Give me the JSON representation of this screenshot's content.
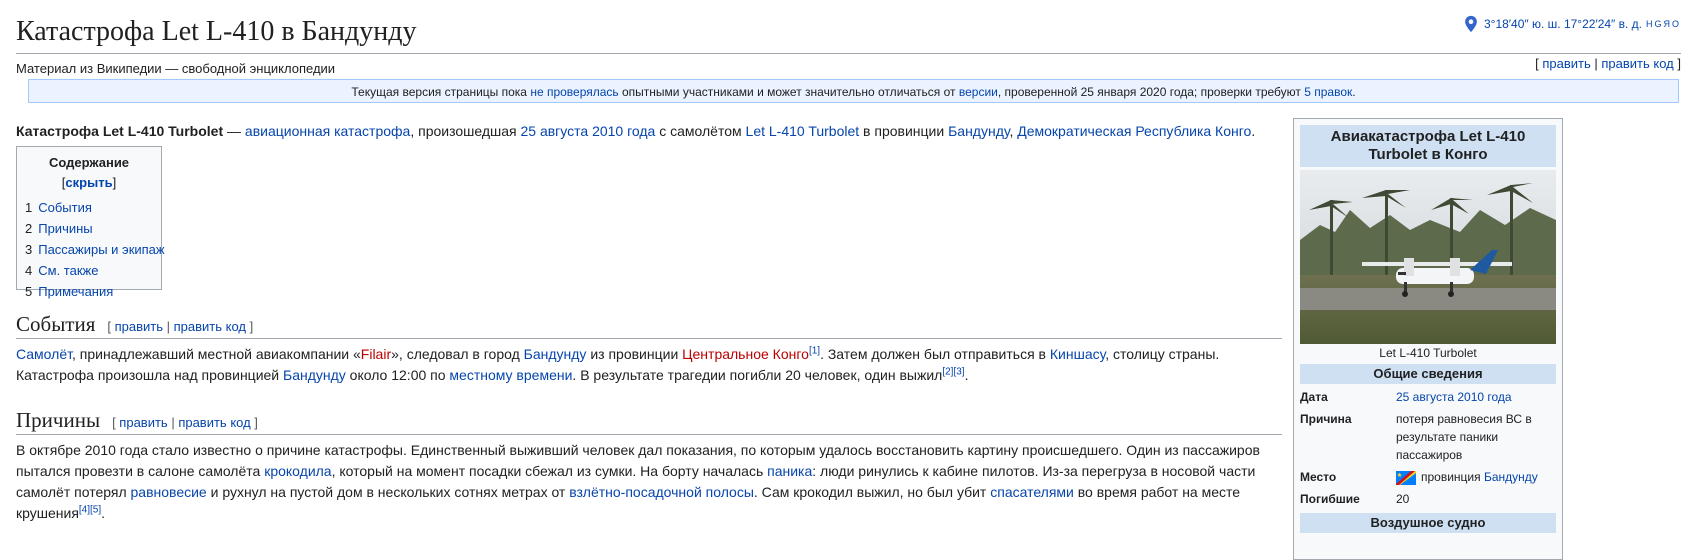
{
  "title": "Катастрофа Let L-410 в Бандунду",
  "tagline": "Материал из Википедии — свободной энциклопедии",
  "coords": {
    "text": "3°18′40″ ю. ш. 17°22′24″ в. д.",
    "geo": "HGЯO"
  },
  "top_edit": {
    "open": "[ ",
    "edit": "править",
    "sep": " | ",
    "edit_code": "править код",
    "close": " ]"
  },
  "notice": {
    "t1": "Текущая версия страницы пока ",
    "l1": "не проверялась",
    "t2": " опытными участниками и может значительно отличаться от ",
    "l2": "версии",
    "t3": ", проверенной 25 января 2020 года; проверки требуют ",
    "l3": "5 правок",
    "t4": "."
  },
  "lead": {
    "bold": "Катастрофа Let L-410 Turbolet",
    "t1": " — ",
    "l1": "авиационная катастрофа",
    "t2": ", произошедшая ",
    "l2": "25 августа 2010 года",
    "t3": " с самолётом ",
    "l3": "Let L-410 Turbolet",
    "t4": " в провинции ",
    "l4": "Бандунду",
    "t5": ", ",
    "l5": "Демократическая Республика Конго",
    "t6": "."
  },
  "toc": {
    "title": "Содержание",
    "toggle_open": " [",
    "toggle": "скрыть",
    "toggle_close": "]",
    "items": [
      {
        "num": "1",
        "label": "События"
      },
      {
        "num": "2",
        "label": "Причины"
      },
      {
        "num": "3",
        "label": "Пассажиры и экипаж"
      },
      {
        "num": "4",
        "label": "См. также"
      },
      {
        "num": "5",
        "label": "Примечания"
      }
    ]
  },
  "edit_links": {
    "open": "[ ",
    "edit": "править",
    "sep": " | ",
    "edit_code": "править код",
    "close": " ]"
  },
  "events": {
    "heading": "События",
    "l1": "Самолёт",
    "t1": ", принадлежавший местной авиакомпании «",
    "l2": "Filair",
    "t2": "», следовал в город ",
    "l3": "Бандунду",
    "t3": " из провинции ",
    "l4": "Центральное Конго",
    "s1": "[1]",
    "t4": ". Затем должен был отправиться в ",
    "l5": "Киншасу",
    "t5": ", столицу страны. Катастрофа произошла над провинцией ",
    "l6": "Бандунду",
    "t6": " около 12:00 по ",
    "l7": "местному времени",
    "t7": ". В результате трагедии погибли 20 человек, один выжил",
    "s2": "[2]",
    "s3": "[3]",
    "t8": "."
  },
  "causes": {
    "heading": "Причины",
    "t1": "В октябре 2010 года стало известно о причине катастрофы. Единственный выживший человек дал показания, по которым удалось восстановить картину происшедшего. Один из пассажиров пытался провезти в салоне самолёта ",
    "l1": "крокодила",
    "t2": ", который на момент посадки сбежал из сумки. На борту началась ",
    "l2": "паника",
    "t3": ": люди ринулись к кабине пилотов. Из-за перегруза в носовой части самолёт потерял ",
    "l3": "равновесие",
    "t4": " и рухнул на пустой дом в нескольких сотнях метрах от ",
    "l4": "взлётно-посадочной полосы",
    "t5": ". Сам крокодил выжил, но был убит ",
    "l5": "спасателями",
    "t6": " во время работ на месте крушения",
    "s1": "[4]",
    "s2": "[5]",
    "t7": "."
  },
  "infobox": {
    "title": "Авиакатастрофа Let L-410 Turbolet в Конго",
    "caption": "Let L-410 Turbolet",
    "section_general": "Общие сведения",
    "rows": {
      "date_key": "Дата",
      "date_val": "25 августа 2010 года",
      "cause_key": "Причина",
      "cause_val": "потеря равновесия ВС в результате паники пассажиров",
      "place_key": "Место",
      "place_pre": "провинция ",
      "place_link": "Бандунду",
      "dead_key": "Погибшие",
      "dead_val": "20"
    },
    "section_aircraft": "Воздушное судно"
  },
  "colors": {
    "link": "#0645ad",
    "redlink": "#ba0000",
    "notice_bg": "#eaf3ff",
    "infobox_header": "#cee0f2"
  }
}
